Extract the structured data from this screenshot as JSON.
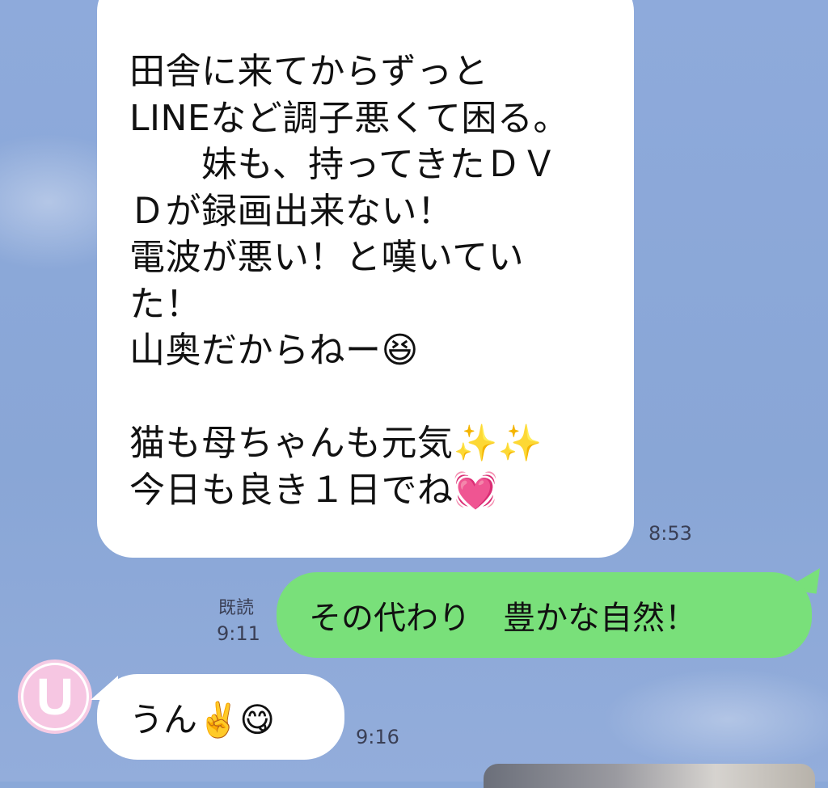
{
  "conversation": {
    "messages": [
      {
        "direction": "incoming",
        "text": "田舎に来てからずっと\nLINEなど調子悪くて困る。\n　　妹も、持ってきたＤＶ\nＤが録画出来ない！\n電波が悪い！と嘆いてい\nた！\n山奥だからねー😆\n\n猫も母ちゃんも元気✨✨\n今日も良き１日でね💓",
        "time": "8:53"
      },
      {
        "direction": "outgoing",
        "text": "その代わり　豊かな自然！",
        "read_label": "既読",
        "time": "9:11"
      },
      {
        "direction": "incoming",
        "text": "うん✌️😋",
        "time": "9:16",
        "avatar_letter": "U"
      }
    ]
  },
  "colors": {
    "background": "#8aa8d8",
    "incoming_bubble": "#ffffff",
    "outgoing_bubble": "#79e07a",
    "avatar_pink": "#f6c6e2"
  }
}
